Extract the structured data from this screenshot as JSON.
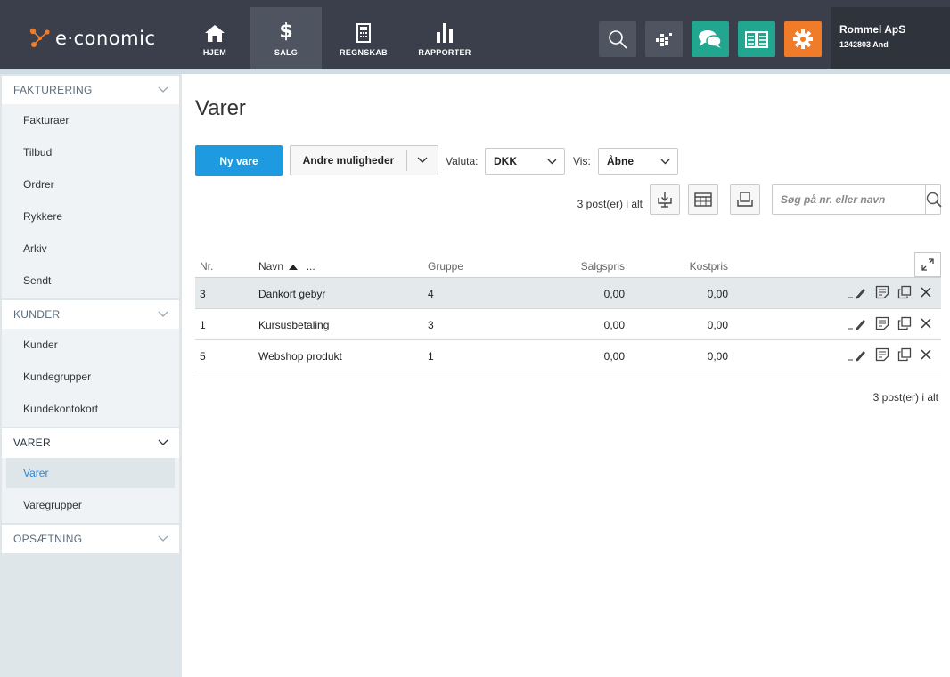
{
  "header": {
    "logo_text": "e·conomic",
    "nav": [
      {
        "label": "HJEM",
        "icon": "home-icon"
      },
      {
        "label": "SALG",
        "icon": "dollar-icon"
      },
      {
        "label": "REGNSKAB",
        "icon": "calculator-icon"
      },
      {
        "label": "RAPPORTER",
        "icon": "bar-chart-icon"
      }
    ],
    "company_name": "Rommel ApS",
    "company_id": "1242803 And",
    "colors": {
      "topbar": "#3a3f4b",
      "green": "#23a68f",
      "orange": "#f07c2a"
    }
  },
  "sidebar": {
    "sections": [
      {
        "title": "FAKTURERING",
        "items": [
          "Fakturaer",
          "Tilbud",
          "Ordrer",
          "Rykkere",
          "Arkiv",
          "Sendt"
        ]
      },
      {
        "title": "KUNDER",
        "items": [
          "Kunder",
          "Kundegrupper",
          "Kundekontokort"
        ]
      },
      {
        "title": "VARER",
        "items": [
          "Varer",
          "Varegrupper"
        ],
        "active_item": "Varer"
      },
      {
        "title": "OPSÆTNING",
        "items": []
      }
    ]
  },
  "main": {
    "title": "Varer",
    "new_button": "Ny vare",
    "more_button": "Andre muligheder",
    "currency_label": "Valuta:",
    "currency_value": "DKK",
    "show_label": "Vis:",
    "show_value": "Åbne",
    "count_text": "3 post(er) i alt",
    "search_placeholder": "Søg på nr. eller navn",
    "columns": {
      "nr": "Nr.",
      "navn": "Navn",
      "navn_more": "...",
      "gruppe": "Gruppe",
      "salgspris": "Salgspris",
      "kostpris": "Kostpris"
    },
    "rows": [
      {
        "nr": "3",
        "navn": "Dankort gebyr",
        "gruppe": "4",
        "salgspris": "0,00",
        "kostpris": "0,00"
      },
      {
        "nr": "1",
        "navn": "Kursusbetaling",
        "gruppe": "3",
        "salgspris": "0,00",
        "kostpris": "0,00"
      },
      {
        "nr": "5",
        "navn": "Webshop produkt",
        "gruppe": "1",
        "salgspris": "0,00",
        "kostpris": "0,00"
      }
    ]
  }
}
